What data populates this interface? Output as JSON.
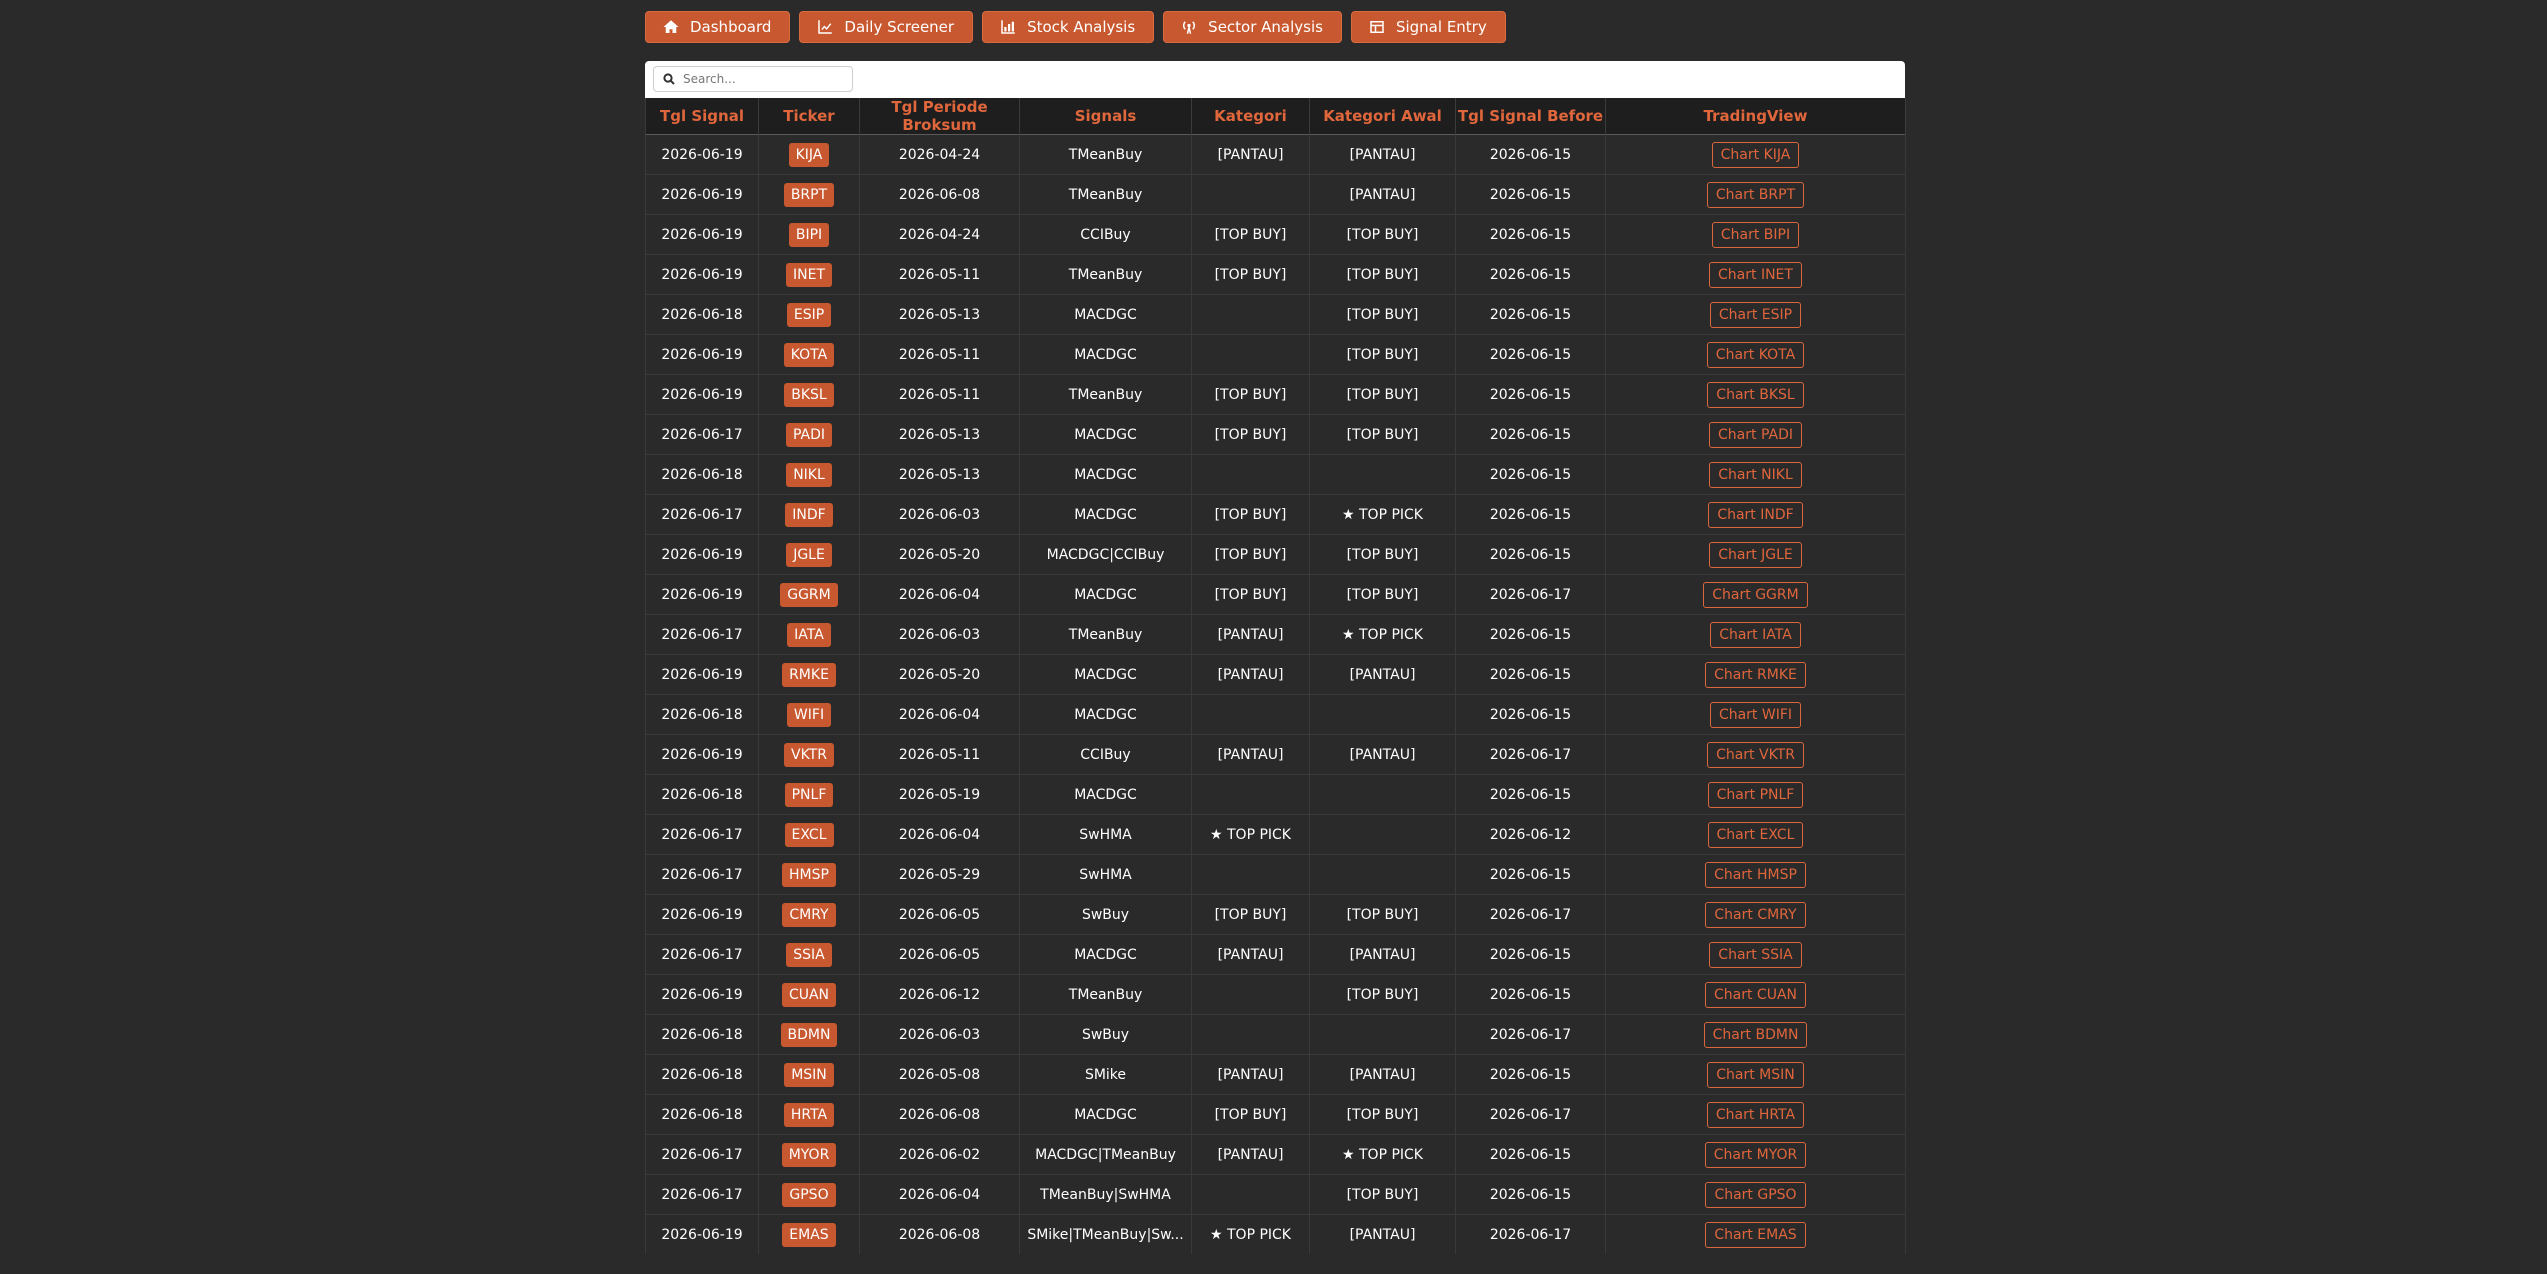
{
  "nav": [
    {
      "label": "Dashboard",
      "icon": "home-icon"
    },
    {
      "label": "Daily Screener",
      "icon": "line-chart-icon"
    },
    {
      "label": "Stock Analysis",
      "icon": "bar-chart-icon"
    },
    {
      "label": "Sector Analysis",
      "icon": "broadcast-icon"
    },
    {
      "label": "Signal Entry",
      "icon": "table-icon"
    }
  ],
  "search": {
    "placeholder": "Search..."
  },
  "table": {
    "headers": [
      "Tgl Signal",
      "Ticker",
      "Tgl Periode Broksum",
      "Signals",
      "Kategori",
      "Kategori Awal",
      "Tgl Signal Before",
      "TradingView"
    ],
    "rows": [
      [
        "2026-06-19",
        "KIJA",
        "2026-04-24",
        "TMeanBuy",
        "[PANTAU]",
        "[PANTAU]",
        "2026-06-15",
        "Chart KIJA"
      ],
      [
        "2026-06-19",
        "BRPT",
        "2026-06-08",
        "TMeanBuy",
        "",
        "[PANTAU]",
        "2026-06-15",
        "Chart BRPT"
      ],
      [
        "2026-06-19",
        "BIPI",
        "2026-04-24",
        "CCIBuy",
        "[TOP BUY]",
        "[TOP BUY]",
        "2026-06-15",
        "Chart BIPI"
      ],
      [
        "2026-06-19",
        "INET",
        "2026-05-11",
        "TMeanBuy",
        "[TOP BUY]",
        "[TOP BUY]",
        "2026-06-15",
        "Chart INET"
      ],
      [
        "2026-06-18",
        "ESIP",
        "2026-05-13",
        "MACDGC",
        "",
        "[TOP BUY]",
        "2026-06-15",
        "Chart ESIP"
      ],
      [
        "2026-06-19",
        "KOTA",
        "2026-05-11",
        "MACDGC",
        "",
        "[TOP BUY]",
        "2026-06-15",
        "Chart KOTA"
      ],
      [
        "2026-06-19",
        "BKSL",
        "2026-05-11",
        "TMeanBuy",
        "[TOP BUY]",
        "[TOP BUY]",
        "2026-06-15",
        "Chart BKSL"
      ],
      [
        "2026-06-17",
        "PADI",
        "2026-05-13",
        "MACDGC",
        "[TOP BUY]",
        "[TOP BUY]",
        "2026-06-15",
        "Chart PADI"
      ],
      [
        "2026-06-18",
        "NIKL",
        "2026-05-13",
        "MACDGC",
        "",
        "",
        "2026-06-15",
        "Chart NIKL"
      ],
      [
        "2026-06-17",
        "INDF",
        "2026-06-03",
        "MACDGC",
        "[TOP BUY]",
        "★ TOP PICK",
        "2026-06-15",
        "Chart INDF"
      ],
      [
        "2026-06-19",
        "JGLE",
        "2026-05-20",
        "MACDGC|CCIBuy",
        "[TOP BUY]",
        "[TOP BUY]",
        "2026-06-15",
        "Chart JGLE"
      ],
      [
        "2026-06-19",
        "GGRM",
        "2026-06-04",
        "MACDGC",
        "[TOP BUY]",
        "[TOP BUY]",
        "2026-06-17",
        "Chart GGRM"
      ],
      [
        "2026-06-17",
        "IATA",
        "2026-06-03",
        "TMeanBuy",
        "[PANTAU]",
        "★ TOP PICK",
        "2026-06-15",
        "Chart IATA"
      ],
      [
        "2026-06-19",
        "RMKE",
        "2026-05-20",
        "MACDGC",
        "[PANTAU]",
        "[PANTAU]",
        "2026-06-15",
        "Chart RMKE"
      ],
      [
        "2026-06-18",
        "WIFI",
        "2026-06-04",
        "MACDGC",
        "",
        "",
        "2026-06-15",
        "Chart WIFI"
      ],
      [
        "2026-06-19",
        "VKTR",
        "2026-05-11",
        "CCIBuy",
        "[PANTAU]",
        "[PANTAU]",
        "2026-06-17",
        "Chart VKTR"
      ],
      [
        "2026-06-18",
        "PNLF",
        "2026-05-19",
        "MACDGC",
        "",
        "",
        "2026-06-15",
        "Chart PNLF"
      ],
      [
        "2026-06-17",
        "EXCL",
        "2026-06-04",
        "SwHMA",
        "★ TOP PICK",
        "",
        "2026-06-12",
        "Chart EXCL"
      ],
      [
        "2026-06-17",
        "HMSP",
        "2026-05-29",
        "SwHMA",
        "",
        "",
        "2026-06-15",
        "Chart HMSP"
      ],
      [
        "2026-06-19",
        "CMRY",
        "2026-06-05",
        "SwBuy",
        "[TOP BUY]",
        "[TOP BUY]",
        "2026-06-17",
        "Chart CMRY"
      ],
      [
        "2026-06-17",
        "SSIA",
        "2026-06-05",
        "MACDGC",
        "[PANTAU]",
        "[PANTAU]",
        "2026-06-15",
        "Chart SSIA"
      ],
      [
        "2026-06-19",
        "CUAN",
        "2026-06-12",
        "TMeanBuy",
        "",
        "[TOP BUY]",
        "2026-06-15",
        "Chart CUAN"
      ],
      [
        "2026-06-18",
        "BDMN",
        "2026-06-03",
        "SwBuy",
        "",
        "",
        "2026-06-17",
        "Chart BDMN"
      ],
      [
        "2026-06-18",
        "MSIN",
        "2026-05-08",
        "SMike",
        "[PANTAU]",
        "[PANTAU]",
        "2026-06-15",
        "Chart MSIN"
      ],
      [
        "2026-06-18",
        "HRTA",
        "2026-06-08",
        "MACDGC",
        "[TOP BUY]",
        "[TOP BUY]",
        "2026-06-17",
        "Chart HRTA"
      ],
      [
        "2026-06-17",
        "MYOR",
        "2026-06-02",
        "MACDGC|TMeanBuy",
        "[PANTAU]",
        "★ TOP PICK",
        "2026-06-15",
        "Chart MYOR"
      ],
      [
        "2026-06-17",
        "GPSO",
        "2026-06-04",
        "TMeanBuy|SwHMA",
        "",
        "[TOP BUY]",
        "2026-06-15",
        "Chart GPSO"
      ],
      [
        "2026-06-19",
        "EMAS",
        "2026-06-08",
        "SMike|TMeanBuy|Sw...",
        "★ TOP PICK",
        "[PANTAU]",
        "2026-06-17",
        "Chart EMAS"
      ]
    ]
  }
}
